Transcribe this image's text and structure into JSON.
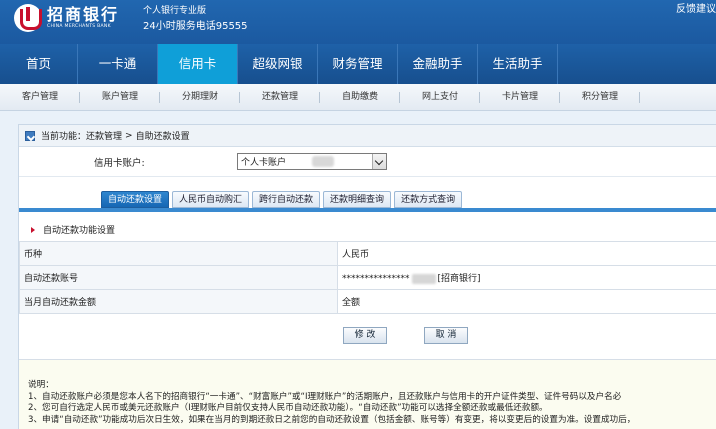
{
  "header": {
    "logo_cn": "招商银行",
    "logo_en": "CHINA MERCHANTS BANK",
    "subtitle": "个人银行专业版",
    "phone_line": "24小时服务电话95555",
    "feedback_link": "反馈建议"
  },
  "nav": [
    "首页",
    "一卡通",
    "信用卡",
    "超级网银",
    "财务管理",
    "金融助手",
    "生活助手"
  ],
  "nav_active": "信用卡",
  "subnav": [
    "客户管理",
    "账户管理",
    "分期理财",
    "还款管理",
    "自助缴费",
    "网上支付",
    "卡片管理",
    "积分管理"
  ],
  "breadcrumb": {
    "label": "当前功能：",
    "path1": "还款管理",
    "sep": ">",
    "path2": "自助还款设置"
  },
  "account": {
    "label": "信用卡账户:",
    "value": "个人卡账户"
  },
  "tabs": [
    "自动还款设置",
    "人民币自动购汇",
    "跨行自动还款",
    "还款明细查询",
    "还款方式查询"
  ],
  "tab_active": "自动还款设置",
  "section_title": "自动还款功能设置",
  "table": [
    {
      "key": "币种",
      "value": "人民币"
    },
    {
      "key": "自动还款账号",
      "value_prefix": "***************",
      "value_suffix": "[招商银行]"
    },
    {
      "key": "当月自动还款金额",
      "value": "全额"
    }
  ],
  "buttons": {
    "modify": "修 改",
    "cancel": "取 消"
  },
  "notes": {
    "title": "说明：",
    "line1": "1、自动还款账户必须是您本人名下的招商银行“一卡通”、“财富账户”或“I理财账户”的活期账户，且还款账户与信用卡的开户证件类型、证件号码以及户名必",
    "line2": "2、您可自行选定人民币或美元还款账户（I理财账户目前仅支持人民币自动还款功能）。“自动还款”功能可以选择全额还款或最低还款额。",
    "line3": "3、申请“自动还款”功能成功后次日生效，如果在当月的到期还款日之前您的自动还款设置（包括金额、账号等）有变更，将以变更后的设置为准。设置成功后，"
  }
}
